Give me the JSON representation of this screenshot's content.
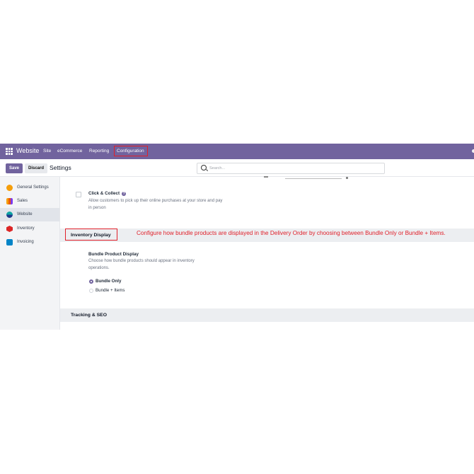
{
  "navbar": {
    "brand": "Website",
    "menu": [
      "Site",
      "eCommerce",
      "Reporting",
      "Configuration"
    ],
    "bg_color": "#71639e"
  },
  "control_panel": {
    "save_label": "Save",
    "discard_label": "Discard",
    "breadcrumb": "Settings",
    "search_placeholder": "Search..."
  },
  "sidebar": {
    "items": [
      {
        "label": "General Settings",
        "icon": "general-settings-icon",
        "color": "#f59e0b"
      },
      {
        "label": "Sales",
        "icon": "sales-icon",
        "color": "#ea580c"
      },
      {
        "label": "Website",
        "icon": "website-icon",
        "color": "#0ea5a4",
        "active": true
      },
      {
        "label": "Inventory",
        "icon": "inventory-icon",
        "color": "#dc2626"
      },
      {
        "label": "Invoicing",
        "icon": "invoicing-icon",
        "color": "#0284c7"
      }
    ]
  },
  "settings": {
    "click_collect": {
      "title": "Click & Collect",
      "description": "Allow customers to pick up their online purchases at your store and pay in person"
    },
    "inventory_section": {
      "title": "Inventory Display"
    },
    "bundle_display": {
      "title": "Bundle Product Display",
      "description": "Choose how bundle products should appear in inventory operations.",
      "options": [
        "Bundle Only",
        "Bundle + Items"
      ],
      "selected": "Bundle Only"
    },
    "tracking_section": {
      "title": "Tracking & SEO"
    }
  },
  "annotation": {
    "text": "Configure how bundle products are displayed in the Delivery Order by choosing between Bundle Only or Bundle + Items.",
    "color": "#e0202a"
  }
}
